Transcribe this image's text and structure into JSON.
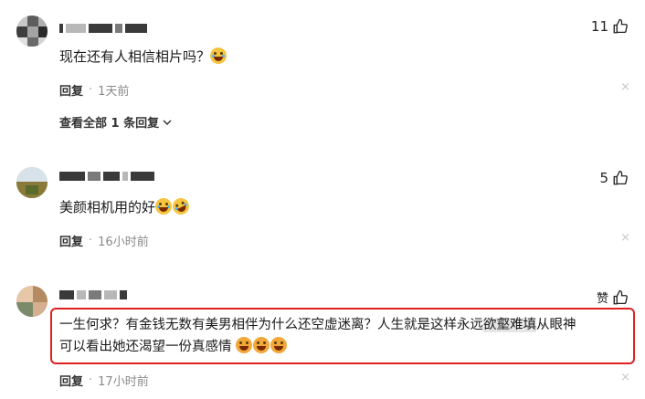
{
  "comments": [
    {
      "text": "现在还有人相信相片吗？",
      "emojis": [
        "laugh-cry"
      ],
      "likes": "11",
      "reply_label": "回复",
      "time": "1天前",
      "close": "×"
    },
    {
      "text": "美颜相机用的好",
      "emojis": [
        "laugh-cry",
        "rolling-laugh"
      ],
      "likes": "5",
      "reply_label": "回复",
      "time": "16小时前",
      "close": "×"
    },
    {
      "text_line1_a": "一生何求？有金钱无数有美男相伴为什么还空虚迷离？人生就是这样永远",
      "text_line1_hl": "欲壑难填",
      "text_line1_b": "从眼神",
      "text_line2": "可以看出她还渴望一份真感情",
      "emojis": [
        "grin",
        "grin",
        "grin"
      ],
      "likes": "赞",
      "reply_label": "回复",
      "time": "17小时前",
      "close": "×"
    }
  ],
  "expand_replies": "查看全部 1 条回复",
  "meta_separator": "·",
  "colors": {
    "highlight_border": "#e02020",
    "meta_gray": "#8a8a8a"
  }
}
